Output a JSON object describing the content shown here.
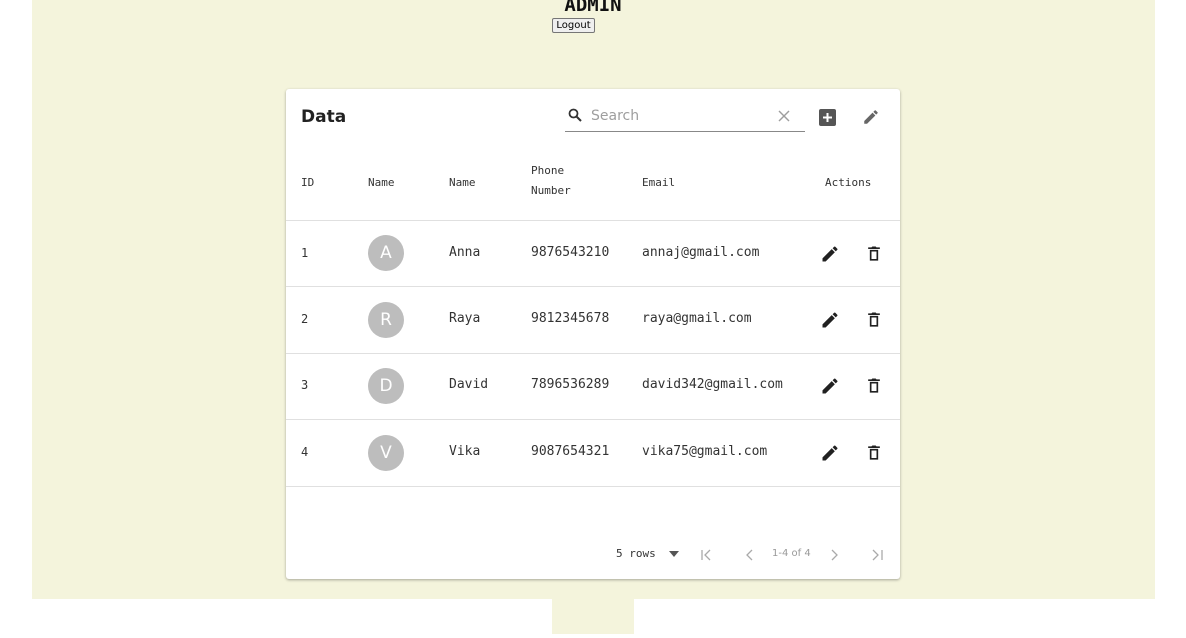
{
  "header": {
    "title": "ADMIN",
    "logout_label": "Logout"
  },
  "table": {
    "title": "Data",
    "search": {
      "placeholder": "Search",
      "value": ""
    },
    "columns": [
      "ID",
      "Name",
      "Name",
      "Phone Number",
      "Email",
      "Actions"
    ],
    "rows": [
      {
        "id": "1",
        "avatar": "A",
        "name": "Anna",
        "phone": "9876543210",
        "email": "annaj@gmail.com"
      },
      {
        "id": "2",
        "avatar": "R",
        "name": "Raya",
        "phone": "9812345678",
        "email": "raya@gmail.com"
      },
      {
        "id": "3",
        "avatar": "D",
        "name": "David",
        "phone": "7896536289",
        "email": "david342@gmail.com"
      },
      {
        "id": "4",
        "avatar": "V",
        "name": "Vika",
        "phone": "9087654321",
        "email": "vika75@gmail.com"
      }
    ],
    "pagination": {
      "rows_per_page": "5 rows",
      "range": "1-4 of 4"
    }
  },
  "colors": {
    "background": "#f4f4dc",
    "avatar": "#bdbdbd",
    "icon": "#212121"
  }
}
